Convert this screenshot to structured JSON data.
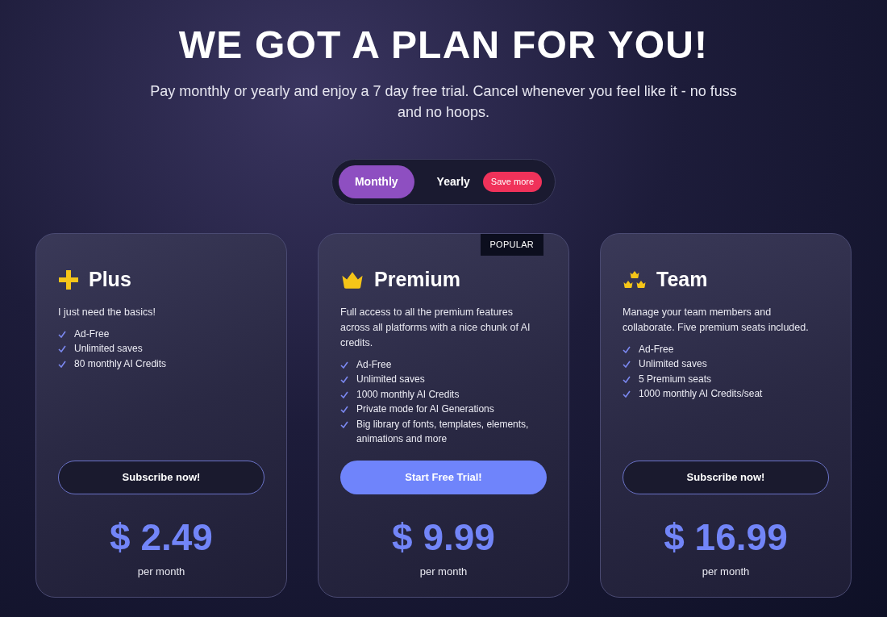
{
  "heading": "WE GOT A PLAN FOR YOU!",
  "subtitle": "Pay monthly or yearly and enjoy a 7 day free trial. Cancel whenever you feel like it - no fuss and no hoops.",
  "billing_toggle": [
    {
      "label": "Monthly",
      "selected": true
    },
    {
      "label": "Yearly",
      "selected": false,
      "badge": "Save more"
    }
  ],
  "plans": [
    {
      "kind": "plus",
      "name": "Plus",
      "description": "I just need the basics!",
      "features": [
        "Ad-Free",
        "Unlimited saves",
        "80 monthly AI Credits"
      ],
      "button": {
        "label": "Subscribe now!",
        "kind": "outline"
      },
      "price": "$ 2.49",
      "period": "per month"
    },
    {
      "kind": "crown",
      "name": "Premium",
      "badge": "POPULAR",
      "description": "Full access to all the premium features across all platforms with a nice chunk of AI credits.",
      "features": [
        "Ad-Free",
        "Unlimited saves",
        "1000 monthly AI Credits",
        "Private mode for AI Generations",
        "Big library of fonts, templates, elements, animations and more"
      ],
      "button": {
        "label": "Start Free Trial!",
        "kind": "primary"
      },
      "price": "$ 9.99",
      "period": "per month"
    },
    {
      "kind": "crowns",
      "name": "Team",
      "description": "Manage your team members and collaborate. Five premium seats included.",
      "features": [
        "Ad-Free",
        "Unlimited saves",
        "5 Premium seats",
        "1000 monthly AI Credits/seat"
      ],
      "button": {
        "label": "Subscribe now!",
        "kind": "outline"
      },
      "price": "$ 16.99",
      "period": "per month"
    }
  ]
}
